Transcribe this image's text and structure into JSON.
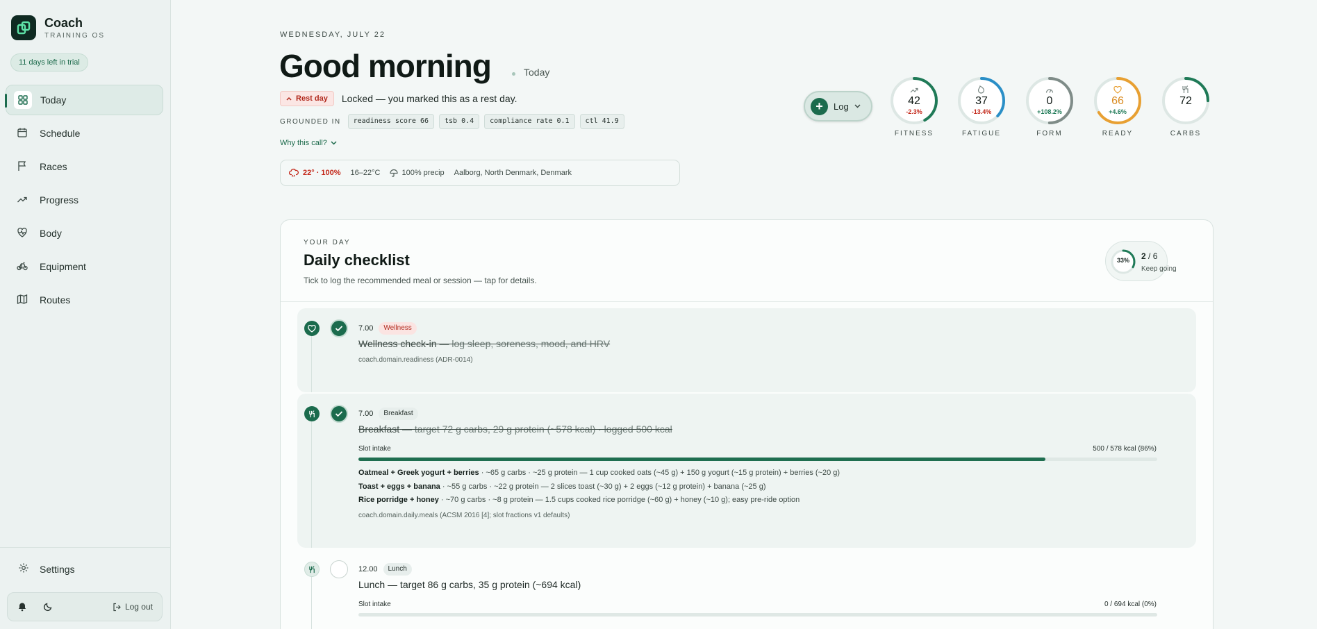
{
  "app": {
    "name": "Coach",
    "subtitle": "TRAINING OS",
    "trial": "11 days left in trial"
  },
  "sidebar": {
    "items": [
      {
        "label": "Today",
        "icon": "grid-icon",
        "active": true
      },
      {
        "label": "Schedule",
        "icon": "calendar-icon"
      },
      {
        "label": "Races",
        "icon": "flag-icon"
      },
      {
        "label": "Progress",
        "icon": "trending-up-icon"
      },
      {
        "label": "Body",
        "icon": "heart-pulse-icon"
      },
      {
        "label": "Equipment",
        "icon": "bicycle-icon"
      },
      {
        "label": "Routes",
        "icon": "map-icon"
      }
    ],
    "settings": "Settings",
    "logout": "Log out"
  },
  "header": {
    "date": "WEDNESDAY, JULY 22",
    "greeting": "Good morning",
    "today": "Today",
    "rest_badge": "Rest day",
    "rest_text": "Locked — you marked this as a rest day.",
    "grounded_label": "GROUNDED IN",
    "chips": [
      "readiness score 66",
      "tsb 0.4",
      "compliance rate 0.1",
      "ctl 41.9"
    ],
    "why": "Why this call?",
    "weather": {
      "temp": "22° · 100%",
      "range": "16–22°C",
      "precip": "100% precip",
      "location": "Aalborg, North Denmark, Denmark"
    }
  },
  "log_button": {
    "label": "Log"
  },
  "gauges": [
    {
      "label": "FITNESS",
      "value": "42",
      "delta": "-2.3%",
      "delta_color": "#c3281a",
      "ring_color": "#1f7a57",
      "progress": 0.42,
      "icon": "trending-up-icon"
    },
    {
      "label": "FATIGUE",
      "value": "37",
      "delta": "-13.4%",
      "delta_color": "#c3281a",
      "ring_color": "#2a8fc7",
      "progress": 0.37,
      "icon": "flame-icon"
    },
    {
      "label": "FORM",
      "value": "0",
      "delta": "+108.2%",
      "delta_color": "#1f7a57",
      "ring_color": "#7f8c88",
      "progress": 0.5,
      "icon": "gauge-icon"
    },
    {
      "label": "READY",
      "value": "66",
      "delta": "+4.6%",
      "delta_color": "#1f7a57",
      "ring_color": "#e8a032",
      "progress": 0.66,
      "icon": "heart-icon",
      "value_color": "#d98a1f"
    },
    {
      "label": "CARBS",
      "value": "72",
      "delta": "",
      "delta_color": "#1f7a57",
      "ring_color": "#1f7a57",
      "progress": 0.25,
      "icon": "fork-knife-icon"
    }
  ],
  "checklist": {
    "eyebrow": "YOUR DAY",
    "title": "Daily checklist",
    "subtitle": "Tick to log the recommended meal or session — tap for details.",
    "progress": {
      "percent_label": "33%",
      "fraction": 0.33,
      "done": "2",
      "total": "/ 6",
      "message": "Keep going"
    },
    "items": [
      {
        "time": "7.00",
        "tag": "Wellness",
        "done": true,
        "title": "Wellness check-in",
        "detail": " — log sleep, soreness, mood, and HRV",
        "source": "coach.domain.readiness (ADR-0014)"
      },
      {
        "time": "7.00",
        "tag": "Breakfast",
        "done": true,
        "title": "Breakfast",
        "detail": " — target 72 g carbs, 29 g protein (~578 kcal) · logged 500 kcal",
        "intake_label": "Slot intake",
        "intake_value": "500 / 578 kcal (86%)",
        "intake_fraction": 0.86,
        "options": [
          {
            "name": "Oatmeal + Greek yogurt + berries",
            "desc": " · ~65 g carbs · ~25 g protein — 1 cup cooked oats (~45 g) + 150 g yogurt (~15 g protein) + berries (~20 g)"
          },
          {
            "name": "Toast + eggs + banana",
            "desc": " · ~55 g carbs · ~22 g protein — 2 slices toast (~30 g) + 2 eggs (~12 g protein) + banana (~25 g)"
          },
          {
            "name": "Rice porridge + honey",
            "desc": " · ~70 g carbs · ~8 g protein — 1.5 cups cooked rice porridge (~60 g) + honey (~10 g); easy pre-ride option"
          }
        ],
        "source": "coach.domain.daily.meals (ACSM 2016 [4]; slot fractions v1 defaults)"
      },
      {
        "time": "12.00",
        "tag": "Lunch",
        "done": false,
        "title": "Lunch — target 86 g carbs, 35 g protein (~694 kcal)",
        "intake_label": "Slot intake",
        "intake_value": "0 / 694 kcal (0%)",
        "intake_fraction": 0
      }
    ]
  }
}
